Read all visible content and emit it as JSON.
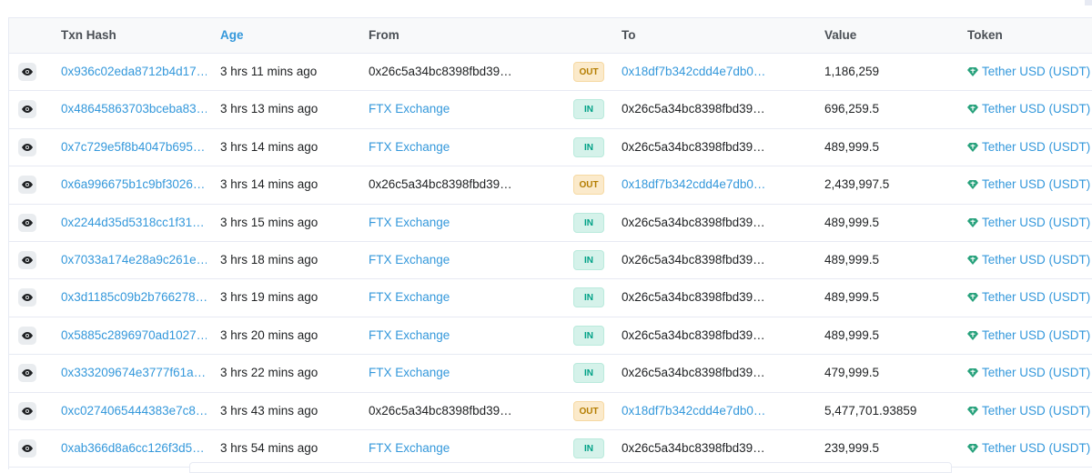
{
  "columns": {
    "txn_hash": "Txn Hash",
    "age": "Age",
    "from": "From",
    "to": "To",
    "value": "Value",
    "token": "Token"
  },
  "colors": {
    "link": "#3498db",
    "out_badge_bg": "#fbeacb",
    "out_badge_text": "#b47d00",
    "in_badge_bg": "#d5f2ea",
    "in_badge_text": "#00a186",
    "token_icon": "#26a17b"
  },
  "icons": {
    "row_view": "eye-icon",
    "token": "tether-gem-icon"
  },
  "rows": [
    {
      "hash": "0x936c02eda8712b4d17…",
      "age": "3 hrs 11 mins ago",
      "from": "0x26c5a34bc8398fbd39…",
      "from_link": false,
      "direction": "OUT",
      "to": "0x18df7b342cdd4e7db0…",
      "to_link": true,
      "value": "1,186,259",
      "token": "Tether USD (USDT)"
    },
    {
      "hash": "0x48645863703bceba83…",
      "age": "3 hrs 13 mins ago",
      "from": "FTX Exchange",
      "from_link": true,
      "direction": "IN",
      "to": "0x26c5a34bc8398fbd39…",
      "to_link": false,
      "value": "696,259.5",
      "token": "Tether USD (USDT)"
    },
    {
      "hash": "0x7c729e5f8b4047b695…",
      "age": "3 hrs 14 mins ago",
      "from": "FTX Exchange",
      "from_link": true,
      "direction": "IN",
      "to": "0x26c5a34bc8398fbd39…",
      "to_link": false,
      "value": "489,999.5",
      "token": "Tether USD (USDT)"
    },
    {
      "hash": "0x6a996675b1c9bf3026…",
      "age": "3 hrs 14 mins ago",
      "from": "0x26c5a34bc8398fbd39…",
      "from_link": false,
      "direction": "OUT",
      "to": "0x18df7b342cdd4e7db0…",
      "to_link": true,
      "value": "2,439,997.5",
      "token": "Tether USD (USDT)"
    },
    {
      "hash": "0x2244d35d5318cc1f31…",
      "age": "3 hrs 15 mins ago",
      "from": "FTX Exchange",
      "from_link": true,
      "direction": "IN",
      "to": "0x26c5a34bc8398fbd39…",
      "to_link": false,
      "value": "489,999.5",
      "token": "Tether USD (USDT)"
    },
    {
      "hash": "0x7033a174e28a9c261e…",
      "age": "3 hrs 18 mins ago",
      "from": "FTX Exchange",
      "from_link": true,
      "direction": "IN",
      "to": "0x26c5a34bc8398fbd39…",
      "to_link": false,
      "value": "489,999.5",
      "token": "Tether USD (USDT)"
    },
    {
      "hash": "0x3d1185c09b2b766278…",
      "age": "3 hrs 19 mins ago",
      "from": "FTX Exchange",
      "from_link": true,
      "direction": "IN",
      "to": "0x26c5a34bc8398fbd39…",
      "to_link": false,
      "value": "489,999.5",
      "token": "Tether USD (USDT)"
    },
    {
      "hash": "0x5885c2896970ad1027…",
      "age": "3 hrs 20 mins ago",
      "from": "FTX Exchange",
      "from_link": true,
      "direction": "IN",
      "to": "0x26c5a34bc8398fbd39…",
      "to_link": false,
      "value": "489,999.5",
      "token": "Tether USD (USDT)"
    },
    {
      "hash": "0x333209674e3777f61a…",
      "age": "3 hrs 22 mins ago",
      "from": "FTX Exchange",
      "from_link": true,
      "direction": "IN",
      "to": "0x26c5a34bc8398fbd39…",
      "to_link": false,
      "value": "479,999.5",
      "token": "Tether USD (USDT)"
    },
    {
      "hash": "0xc0274065444383e7c8…",
      "age": "3 hrs 43 mins ago",
      "from": "0x26c5a34bc8398fbd39…",
      "from_link": false,
      "direction": "OUT",
      "to": "0x18df7b342cdd4e7db0…",
      "to_link": true,
      "value": "5,477,701.93859",
      "token": "Tether USD (USDT)"
    },
    {
      "hash": "0xab366d8a6cc126f3d5…",
      "age": "3 hrs 54 mins ago",
      "from": "FTX Exchange",
      "from_link": true,
      "direction": "IN",
      "to": "0x26c5a34bc8398fbd39…",
      "to_link": false,
      "value": "239,999.5",
      "token": "Tether USD (USDT)"
    }
  ]
}
